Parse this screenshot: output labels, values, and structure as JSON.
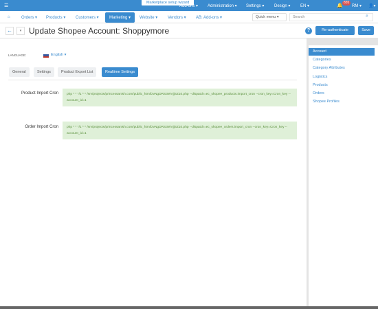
{
  "topbar": {
    "menu_icon": "menu-icon",
    "wizard_label": "Marketplace setup wizard",
    "items": [
      "Add-ons ▾",
      "Administration ▾",
      "Settings ▾",
      "Design ▾",
      "EN ▾"
    ],
    "badge": "835",
    "user": "RM ▾",
    "account_menu": "▾"
  },
  "navbar": {
    "home_icon": "home-icon",
    "items": [
      "Orders ▾",
      "Products ▾",
      "Customers ▾",
      "Marketing ▾",
      "Website ▾",
      "Vendors ▾",
      "AB: Add-ons ▾"
    ],
    "quick_menu": "Quick menu ▾",
    "search_placeholder": "Search"
  },
  "titlebar": {
    "title": "Update Shopee Account: Shoppymore",
    "reauth_label": "Re-authenticate",
    "save_label": "Save"
  },
  "language": {
    "label": "LANGUAGE:",
    "value": "English ▾"
  },
  "tabs": [
    "General",
    "Settings",
    "Product Export List",
    "Realtime Settings"
  ],
  "fields": [
    {
      "label": "Product Import Cron",
      "value": "php * * */1 * * /srv/projects/princessanish.com/public_html/zvNgDRS3WVjjSZ10.php --dispatch=ec_shopee_products.import_cron --cron_key=Cron_key --account_id=1"
    },
    {
      "label": "Order Import Cron",
      "value": "php * * */1 * * /srv/projects/princessanish.com/public_html/zvNgDRS3WVjjSZ10.php --dispatch=ec_shopee_orders.import_cron --cron_key=Cron_key --account_id=1"
    }
  ],
  "sidebar": [
    "Account",
    "Categories",
    "Category Attributes",
    "Logistics",
    "Products",
    "Orders",
    "Shopee Profiles"
  ]
}
